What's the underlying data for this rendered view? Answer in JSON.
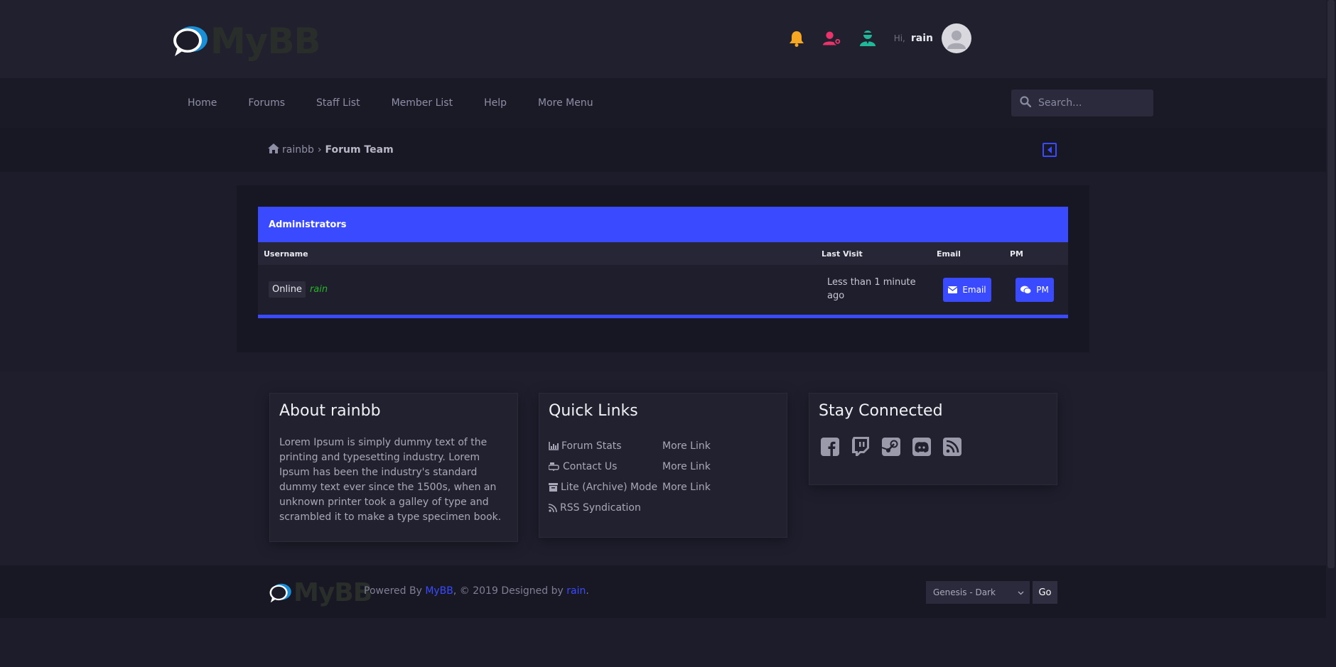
{
  "header": {
    "logo_text": "MyBB",
    "greeting": "Hi,",
    "username": "rain",
    "colors": {
      "bell": "#f5a623",
      "usercp": "#e8336b",
      "modcp": "#1fb899"
    }
  },
  "nav": {
    "links": [
      {
        "label": "Home"
      },
      {
        "label": "Forums"
      },
      {
        "label": "Staff List"
      },
      {
        "label": "Member List"
      },
      {
        "label": "Help"
      },
      {
        "label": "More Menu"
      }
    ],
    "search_placeholder": "Search..."
  },
  "breadcrumb": {
    "home": "rainbb",
    "separator": "›",
    "current": "Forum Team"
  },
  "team": {
    "group_title": "Administrators",
    "columns": {
      "username": "Username",
      "last_visit": "Last Visit",
      "email": "Email",
      "pm": "PM"
    },
    "rows": [
      {
        "status": "Online",
        "name": "rain",
        "last_visit": "Less than 1 minute ago",
        "email_btn": "Email",
        "pm_btn": "PM"
      }
    ]
  },
  "footer": {
    "about": {
      "title": "About rainbb",
      "text": "Lorem Ipsum is simply dummy text of the printing and typesetting industry. Lorem Ipsum has been the industry's standard dummy text ever since the 1500s, when an unknown printer took a galley of type and scrambled it to make a type specimen book."
    },
    "quick_links": {
      "title": "Quick Links",
      "left": [
        "Forum Stats",
        "Contact Us",
        "Lite (Archive) Mode",
        "RSS Syndication"
      ],
      "right": [
        "More Link",
        "More Link",
        "More Link"
      ]
    },
    "connected": {
      "title": "Stay Connected",
      "icons": [
        "facebook-icon",
        "twitch-icon",
        "steam-icon",
        "discord-icon",
        "rss-icon"
      ]
    }
  },
  "bottom": {
    "logo_text": "MyBB",
    "powered_prefix": "Powered By ",
    "powered_link": "MyBB",
    "powered_mid": ", © 2019 Designed by ",
    "designer_link": "rain",
    "powered_suffix": ".",
    "theme_selected": "Genesis - Dark",
    "go_label": "Go"
  },
  "accent": "#3a4aff"
}
